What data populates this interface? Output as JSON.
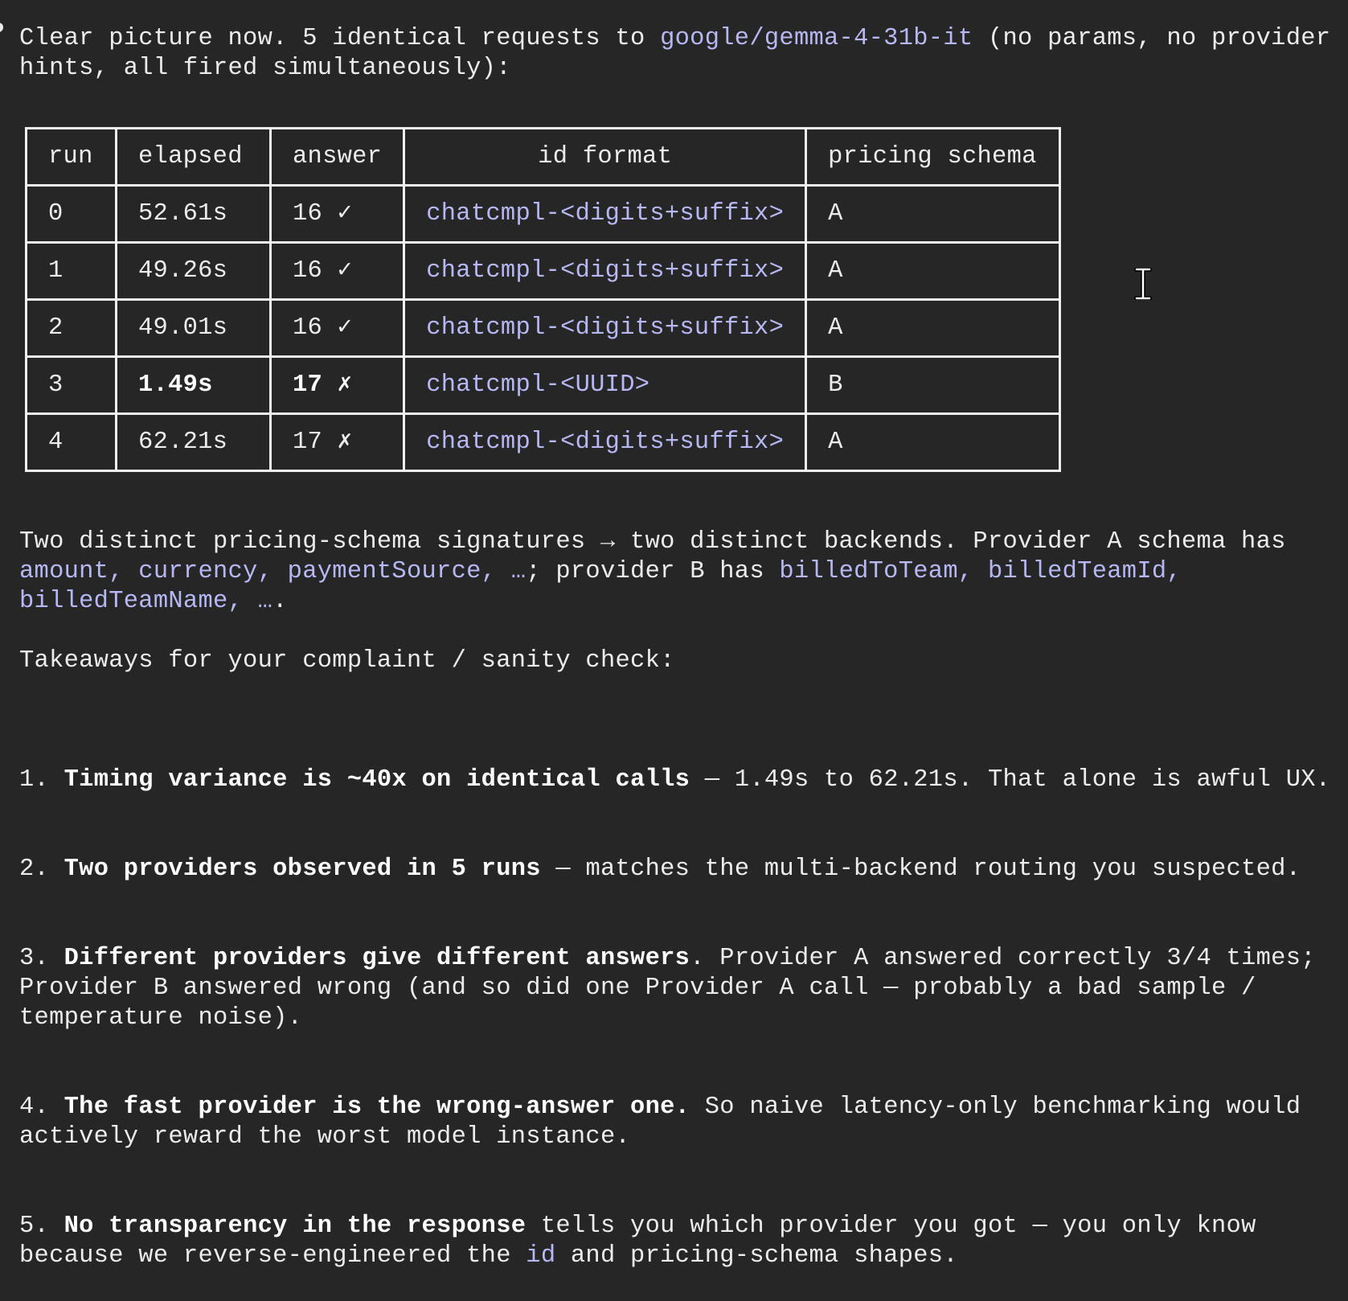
{
  "intro": {
    "prefix": "Clear picture now. 5 identical requests to ",
    "model": "google/gemma-4-31b-it",
    "suffix": " (no params, no provider hints, all fired simultaneously):"
  },
  "table": {
    "headers": [
      "run",
      "elapsed",
      "answer",
      "id format",
      "pricing schema"
    ],
    "rows": [
      {
        "run": "0",
        "elapsed": "52.61s",
        "answer": "16 ✓",
        "id_format": "chatcmpl-<digits+suffix>",
        "pricing_schema": "A",
        "highlight": false
      },
      {
        "run": "1",
        "elapsed": "49.26s",
        "answer": "16 ✓",
        "id_format": "chatcmpl-<digits+suffix>",
        "pricing_schema": "A",
        "highlight": false
      },
      {
        "run": "2",
        "elapsed": "49.01s",
        "answer": "16 ✓",
        "id_format": "chatcmpl-<digits+suffix>",
        "pricing_schema": "A",
        "highlight": false
      },
      {
        "run": "3",
        "elapsed": "1.49s",
        "answer": "17 ✗",
        "id_format": "chatcmpl-<UUID>",
        "pricing_schema": "B",
        "highlight": true
      },
      {
        "run": "4",
        "elapsed": "62.21s",
        "answer": "17 ✗",
        "id_format": "chatcmpl-<digits+suffix>",
        "pricing_schema": "A",
        "highlight": false
      }
    ]
  },
  "summary": {
    "part1": "Two distinct pricing-schema signatures → two distinct backends. Provider A schema has ",
    "schema_a_fields": "amount, currency, paymentSource, …",
    "part2": "; provider B has ",
    "schema_b_fields": "billedToTeam, billedTeamId, billedTeamName, …",
    "part3": "."
  },
  "takeaways_title": "Takeaways for your complaint / sanity check:",
  "takeaways": [
    {
      "num": "1. ",
      "bold": "Timing variance is ~40x on identical calls",
      "text": " — 1.49s to 62.21s. That alone is awful UX."
    },
    {
      "num": "2. ",
      "bold": "Two providers observed in 5 runs",
      "text": " — matches the multi-backend routing you suspected."
    },
    {
      "num": "3. ",
      "bold": "Different providers give different answers",
      "text": ". Provider A answered correctly 3/4 times; Provider B answered wrong (and so did one Provider A call — probably a bad sample / temperature noise)."
    },
    {
      "num": "4. ",
      "bold": "The fast provider is the wrong-answer one.",
      "text": " So naive latency-only benchmarking would actively reward the worst model instance."
    },
    {
      "num": "5. ",
      "bold": "No transparency in the response",
      "text": " tells you which provider you got — you only know because we reverse-engineered the ",
      "code": "id",
      "text2": " and pricing-schema shapes."
    }
  ]
}
